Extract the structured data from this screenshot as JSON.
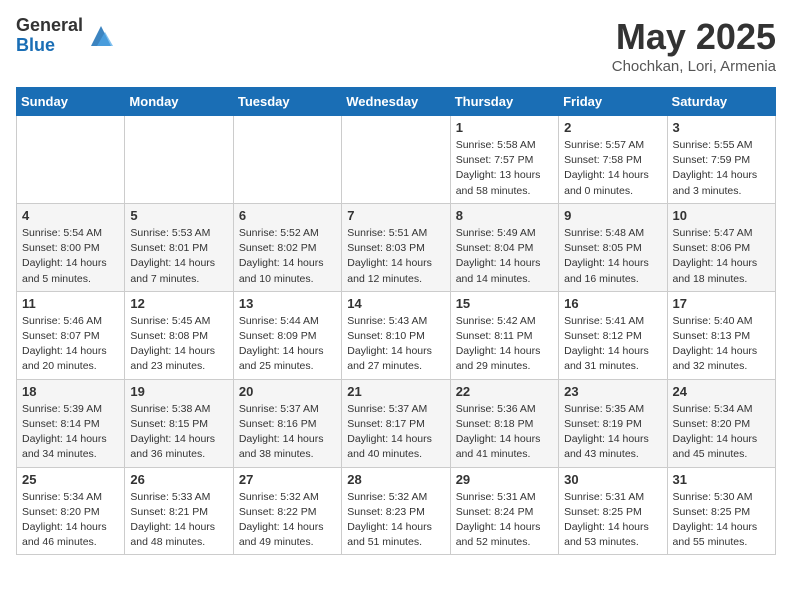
{
  "header": {
    "logo_general": "General",
    "logo_blue": "Blue",
    "month_title": "May 2025",
    "location": "Chochkan, Lori, Armenia"
  },
  "weekdays": [
    "Sunday",
    "Monday",
    "Tuesday",
    "Wednesday",
    "Thursday",
    "Friday",
    "Saturday"
  ],
  "weeks": [
    [
      {
        "day": "",
        "info": ""
      },
      {
        "day": "",
        "info": ""
      },
      {
        "day": "",
        "info": ""
      },
      {
        "day": "",
        "info": ""
      },
      {
        "day": "1",
        "info": "Sunrise: 5:58 AM\nSunset: 7:57 PM\nDaylight: 13 hours\nand 58 minutes."
      },
      {
        "day": "2",
        "info": "Sunrise: 5:57 AM\nSunset: 7:58 PM\nDaylight: 14 hours\nand 0 minutes."
      },
      {
        "day": "3",
        "info": "Sunrise: 5:55 AM\nSunset: 7:59 PM\nDaylight: 14 hours\nand 3 minutes."
      }
    ],
    [
      {
        "day": "4",
        "info": "Sunrise: 5:54 AM\nSunset: 8:00 PM\nDaylight: 14 hours\nand 5 minutes."
      },
      {
        "day": "5",
        "info": "Sunrise: 5:53 AM\nSunset: 8:01 PM\nDaylight: 14 hours\nand 7 minutes."
      },
      {
        "day": "6",
        "info": "Sunrise: 5:52 AM\nSunset: 8:02 PM\nDaylight: 14 hours\nand 10 minutes."
      },
      {
        "day": "7",
        "info": "Sunrise: 5:51 AM\nSunset: 8:03 PM\nDaylight: 14 hours\nand 12 minutes."
      },
      {
        "day": "8",
        "info": "Sunrise: 5:49 AM\nSunset: 8:04 PM\nDaylight: 14 hours\nand 14 minutes."
      },
      {
        "day": "9",
        "info": "Sunrise: 5:48 AM\nSunset: 8:05 PM\nDaylight: 14 hours\nand 16 minutes."
      },
      {
        "day": "10",
        "info": "Sunrise: 5:47 AM\nSunset: 8:06 PM\nDaylight: 14 hours\nand 18 minutes."
      }
    ],
    [
      {
        "day": "11",
        "info": "Sunrise: 5:46 AM\nSunset: 8:07 PM\nDaylight: 14 hours\nand 20 minutes."
      },
      {
        "day": "12",
        "info": "Sunrise: 5:45 AM\nSunset: 8:08 PM\nDaylight: 14 hours\nand 23 minutes."
      },
      {
        "day": "13",
        "info": "Sunrise: 5:44 AM\nSunset: 8:09 PM\nDaylight: 14 hours\nand 25 minutes."
      },
      {
        "day": "14",
        "info": "Sunrise: 5:43 AM\nSunset: 8:10 PM\nDaylight: 14 hours\nand 27 minutes."
      },
      {
        "day": "15",
        "info": "Sunrise: 5:42 AM\nSunset: 8:11 PM\nDaylight: 14 hours\nand 29 minutes."
      },
      {
        "day": "16",
        "info": "Sunrise: 5:41 AM\nSunset: 8:12 PM\nDaylight: 14 hours\nand 31 minutes."
      },
      {
        "day": "17",
        "info": "Sunrise: 5:40 AM\nSunset: 8:13 PM\nDaylight: 14 hours\nand 32 minutes."
      }
    ],
    [
      {
        "day": "18",
        "info": "Sunrise: 5:39 AM\nSunset: 8:14 PM\nDaylight: 14 hours\nand 34 minutes."
      },
      {
        "day": "19",
        "info": "Sunrise: 5:38 AM\nSunset: 8:15 PM\nDaylight: 14 hours\nand 36 minutes."
      },
      {
        "day": "20",
        "info": "Sunrise: 5:37 AM\nSunset: 8:16 PM\nDaylight: 14 hours\nand 38 minutes."
      },
      {
        "day": "21",
        "info": "Sunrise: 5:37 AM\nSunset: 8:17 PM\nDaylight: 14 hours\nand 40 minutes."
      },
      {
        "day": "22",
        "info": "Sunrise: 5:36 AM\nSunset: 8:18 PM\nDaylight: 14 hours\nand 41 minutes."
      },
      {
        "day": "23",
        "info": "Sunrise: 5:35 AM\nSunset: 8:19 PM\nDaylight: 14 hours\nand 43 minutes."
      },
      {
        "day": "24",
        "info": "Sunrise: 5:34 AM\nSunset: 8:20 PM\nDaylight: 14 hours\nand 45 minutes."
      }
    ],
    [
      {
        "day": "25",
        "info": "Sunrise: 5:34 AM\nSunset: 8:20 PM\nDaylight: 14 hours\nand 46 minutes."
      },
      {
        "day": "26",
        "info": "Sunrise: 5:33 AM\nSunset: 8:21 PM\nDaylight: 14 hours\nand 48 minutes."
      },
      {
        "day": "27",
        "info": "Sunrise: 5:32 AM\nSunset: 8:22 PM\nDaylight: 14 hours\nand 49 minutes."
      },
      {
        "day": "28",
        "info": "Sunrise: 5:32 AM\nSunset: 8:23 PM\nDaylight: 14 hours\nand 51 minutes."
      },
      {
        "day": "29",
        "info": "Sunrise: 5:31 AM\nSunset: 8:24 PM\nDaylight: 14 hours\nand 52 minutes."
      },
      {
        "day": "30",
        "info": "Sunrise: 5:31 AM\nSunset: 8:25 PM\nDaylight: 14 hours\nand 53 minutes."
      },
      {
        "day": "31",
        "info": "Sunrise: 5:30 AM\nSunset: 8:25 PM\nDaylight: 14 hours\nand 55 minutes."
      }
    ]
  ]
}
